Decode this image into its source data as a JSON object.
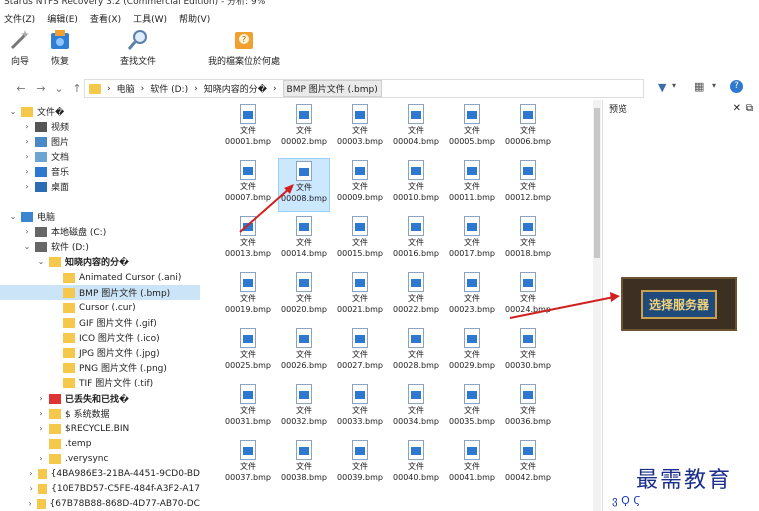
{
  "title": "Starus NTFS Recovery 3.2 (Commercial Edition) - 分析: 9%",
  "menu": [
    "文件(Z)",
    "编辑(E)",
    "查看(X)",
    "工具(W)",
    "帮助(V)"
  ],
  "toolbar": {
    "wizard": "向导",
    "recover": "恢复",
    "find": "查找文件",
    "help": "我的檔案位於何處"
  },
  "breadcrumb": [
    "电脑",
    "软件 (D:)",
    "知晓内容的分�",
    "BMP 图片文件 (.bmp)"
  ],
  "tree": [
    {
      "label": "文件�",
      "depth": 0,
      "tw": "⌄",
      "icon": "#f5c84b",
      "bold": false
    },
    {
      "label": "视频",
      "depth": 1,
      "tw": "›",
      "icon": "#555"
    },
    {
      "label": "图片",
      "depth": 1,
      "tw": "›",
      "icon": "#4a88c8"
    },
    {
      "label": "文档",
      "depth": 1,
      "tw": "›",
      "icon": "#6ea3d6"
    },
    {
      "label": "音乐",
      "depth": 1,
      "tw": "›",
      "icon": "#2f78d0"
    },
    {
      "label": "桌面",
      "depth": 1,
      "tw": "›",
      "icon": "#2a6db5"
    },
    {
      "label": "",
      "depth": 0,
      "tw": "",
      "icon": ""
    },
    {
      "label": "电脑",
      "depth": 0,
      "tw": "⌄",
      "icon": "#3a86d0"
    },
    {
      "label": "本地磁盘 (C:)",
      "depth": 1,
      "tw": "›",
      "icon": "#666"
    },
    {
      "label": "软件 (D:)",
      "depth": 1,
      "tw": "⌄",
      "icon": "#666"
    },
    {
      "label": "知晓内容的分�",
      "depth": 2,
      "tw": "⌄",
      "icon": "#f5c84b",
      "bold": true
    },
    {
      "label": "Animated Cursor (.ani)",
      "depth": 3,
      "tw": "",
      "icon": "#f5c84b"
    },
    {
      "label": "BMP 图片文件 (.bmp)",
      "depth": 3,
      "tw": "",
      "icon": "#f5c84b",
      "sel": true
    },
    {
      "label": "Cursor (.cur)",
      "depth": 3,
      "tw": "",
      "icon": "#f5c84b"
    },
    {
      "label": "GIF 图片文件 (.gif)",
      "depth": 3,
      "tw": "",
      "icon": "#f5c84b"
    },
    {
      "label": "ICO 图片文件 (.ico)",
      "depth": 3,
      "tw": "",
      "icon": "#f5c84b"
    },
    {
      "label": "JPG 图片文件 (.jpg)",
      "depth": 3,
      "tw": "",
      "icon": "#f5c84b"
    },
    {
      "label": "PNG 图片文件 (.png)",
      "depth": 3,
      "tw": "",
      "icon": "#f5c84b"
    },
    {
      "label": "TIF 图片文件 (.tif)",
      "depth": 3,
      "tw": "",
      "icon": "#f5c84b"
    },
    {
      "label": "已丢失和已找�",
      "depth": 2,
      "tw": "›",
      "icon": "#d33",
      "bold": true
    },
    {
      "label": "$ 系统数据",
      "depth": 2,
      "tw": "›",
      "icon": "#f5c84b"
    },
    {
      "label": "$RECYCLE.BIN",
      "depth": 2,
      "tw": "›",
      "icon": "#f5c84b"
    },
    {
      "label": ".temp",
      "depth": 2,
      "tw": "",
      "icon": "#f5c84b"
    },
    {
      "label": ".verysync",
      "depth": 2,
      "tw": "›",
      "icon": "#f5c84b"
    },
    {
      "label": "{4BA986E3-21BA-4451-9CD0-BD",
      "depth": 2,
      "tw": "›",
      "icon": "#f5c84b"
    },
    {
      "label": "{10E7BD57-C5FE-484f-A3F2-A17",
      "depth": 2,
      "tw": "›",
      "icon": "#f5c84b"
    },
    {
      "label": "{67B78B88-868D-4D77-AB70-DC",
      "depth": 2,
      "tw": "›",
      "icon": "#f5c84b"
    }
  ],
  "file_prefix": "文件",
  "files": [
    "00001.bmp",
    "00002.bmp",
    "00003.bmp",
    "00004.bmp",
    "00005.bmp",
    "00006.bmp",
    "00007.bmp",
    "00008.bmp",
    "00009.bmp",
    "00010.bmp",
    "00011.bmp",
    "00012.bmp",
    "00013.bmp",
    "00014.bmp",
    "00015.bmp",
    "00016.bmp",
    "00017.bmp",
    "00018.bmp",
    "00019.bmp",
    "00020.bmp",
    "00021.bmp",
    "00022.bmp",
    "00023.bmp",
    "00024.bmp",
    "00025.bmp",
    "00026.bmp",
    "00027.bmp",
    "00028.bmp",
    "00029.bmp",
    "00030.bmp",
    "00031.bmp",
    "00032.bmp",
    "00033.bmp",
    "00034.bmp",
    "00035.bmp",
    "00036.bmp",
    "00037.bmp",
    "00038.bmp",
    "00039.bmp",
    "00040.bmp",
    "00041.bmp",
    "00042.bmp"
  ],
  "selected_file": "00008.bmp",
  "preview": {
    "title": "预览",
    "image_text": "选择服务器"
  },
  "watermark": "最需教育",
  "watermark_sub": "ვ Ϙ Ϛ"
}
